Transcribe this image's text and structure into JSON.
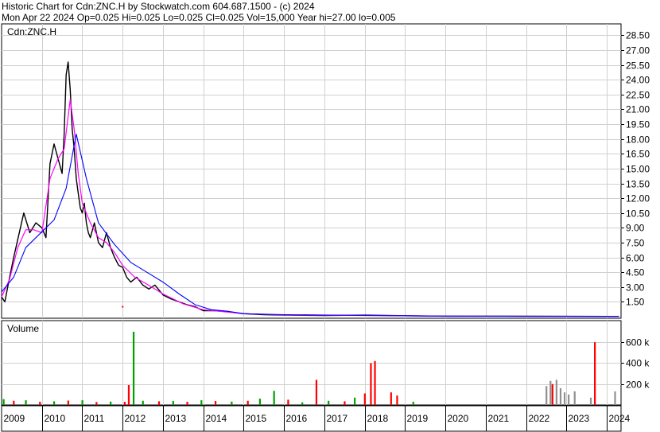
{
  "header": {
    "line1": "Historic Chart for Cdn:ZNC.H by Stockwatch.com 604.687.1500 - (c) 2024",
    "line2": "Mon Apr 22 2024   Op=0.025  Hi=0.025  Lo=0.025  Cl=0.025  Vol=15,000  Year hi=27.00  lo=0.005"
  },
  "chart_data": [
    {
      "type": "line",
      "panel": "price",
      "title": "Cdn:ZNC.H",
      "x_unit": "year (fractional)",
      "xlim": [
        2009.0,
        2024.35
      ],
      "ylim": [
        0,
        29.5
      ],
      "y_ticks": [
        "1.50",
        "3.00",
        "4.50",
        "6.00",
        "7.50",
        "9.00",
        "10.50",
        "12.00",
        "13.50",
        "15.00",
        "16.50",
        "18.00",
        "19.50",
        "21.00",
        "22.50",
        "24.00",
        "25.50",
        "27.00",
        "28.50"
      ],
      "x_tick_labels": [
        "2009",
        "2010",
        "2011",
        "2012",
        "2013",
        "2014",
        "2015",
        "2016",
        "2017",
        "2018",
        "2019",
        "2020",
        "2021",
        "2022",
        "2023",
        "2024"
      ],
      "grid": true,
      "colors": {
        "price": "#000000",
        "ma_short": "#ff00ff",
        "ma_long": "#0000ff",
        "marker": "#ff0000"
      },
      "series": [
        {
          "role": "price",
          "x": [
            2009.0,
            2009.08,
            2009.2,
            2009.3,
            2009.4,
            2009.55,
            2009.7,
            2009.85,
            2010.0,
            2010.1,
            2010.2,
            2010.3,
            2010.4,
            2010.5,
            2010.55,
            2010.6,
            2010.65,
            2010.7,
            2010.75,
            2010.8,
            2010.85,
            2010.9,
            2010.95,
            2011.0,
            2011.05,
            2011.1,
            2011.15,
            2011.2,
            2011.3,
            2011.4,
            2011.5,
            2011.6,
            2011.7,
            2011.8,
            2011.9,
            2012.0,
            2012.1,
            2012.2,
            2012.35,
            2012.5,
            2012.65,
            2012.8,
            2013.0,
            2013.2,
            2013.4,
            2013.6,
            2013.8,
            2014.0,
            2014.3,
            2014.6,
            2015.0,
            2015.5,
            2016.0,
            2017.0,
            2018.0,
            2019.0,
            2020.0,
            2021.0,
            2022.0,
            2023.0,
            2024.0,
            2024.3
          ],
          "y": [
            2.0,
            1.5,
            4.0,
            6.0,
            7.8,
            10.5,
            8.5,
            9.5,
            9.0,
            8.0,
            15.5,
            17.5,
            16.0,
            14.5,
            18.5,
            24.5,
            25.8,
            23.0,
            19.0,
            17.0,
            14.0,
            12.5,
            11.0,
            10.5,
            11.5,
            9.5,
            8.5,
            8.0,
            9.5,
            7.5,
            7.0,
            8.5,
            7.0,
            6.0,
            5.2,
            5.0,
            4.0,
            3.5,
            4.0,
            3.2,
            2.8,
            3.2,
            2.2,
            1.8,
            1.5,
            1.2,
            1.0,
            0.6,
            0.6,
            0.5,
            0.3,
            0.2,
            0.15,
            0.12,
            0.15,
            0.1,
            0.05,
            0.05,
            0.04,
            0.03,
            0.025,
            0.025
          ]
        },
        {
          "role": "ma_short",
          "x": [
            2009.0,
            2009.2,
            2009.4,
            2009.6,
            2009.8,
            2010.0,
            2010.2,
            2010.4,
            2010.55,
            2010.7,
            2010.8,
            2010.9,
            2011.0,
            2011.2,
            2011.4,
            2011.6,
            2011.8,
            2012.0,
            2012.3,
            2012.6,
            2013.0,
            2013.5,
            2014.0,
            2014.5,
            2015.0,
            2016.0,
            2018.0,
            2020.0,
            2022.0,
            2024.3
          ],
          "y": [
            2.0,
            3.8,
            7.0,
            8.8,
            8.8,
            8.5,
            14.0,
            16.0,
            17.0,
            22.0,
            19.0,
            14.5,
            11.5,
            9.5,
            8.0,
            7.5,
            6.5,
            5.2,
            4.0,
            3.3,
            2.3,
            1.3,
            0.7,
            0.5,
            0.3,
            0.18,
            0.12,
            0.06,
            0.04,
            0.03
          ]
        },
        {
          "role": "ma_long",
          "x": [
            2009.0,
            2009.3,
            2009.6,
            2010.0,
            2010.3,
            2010.6,
            2010.85,
            2011.1,
            2011.4,
            2011.8,
            2012.2,
            2012.6,
            2013.0,
            2013.4,
            2013.8,
            2014.2,
            2014.6,
            2015.0,
            2016.0,
            2018.0,
            2020.0,
            2022.0,
            2024.3
          ],
          "y": [
            2.5,
            4.0,
            7.0,
            8.6,
            9.8,
            13.0,
            18.5,
            14.0,
            9.5,
            7.3,
            5.5,
            4.5,
            3.5,
            2.3,
            1.2,
            0.7,
            0.55,
            0.3,
            0.2,
            0.12,
            0.06,
            0.04,
            0.03
          ]
        },
        {
          "role": "marker",
          "x": [
            2012.0
          ],
          "y": [
            1.0
          ]
        }
      ]
    },
    {
      "type": "bar",
      "panel": "volume",
      "title": "Volume",
      "x_unit": "year (fractional)",
      "xlim": [
        2009.0,
        2024.35
      ],
      "ylim": [
        0,
        700000
      ],
      "y_ticks": [
        "200 k",
        "400 k",
        "600 k"
      ],
      "y_tick_values": [
        200000,
        400000,
        600000
      ],
      "colors": {
        "up": "#00a000",
        "down": "#ff0000",
        "neutral": "#909090"
      },
      "x": [
        2009.05,
        2009.3,
        2009.6,
        2009.95,
        2010.3,
        2010.65,
        2011.0,
        2011.35,
        2011.7,
        2012.05,
        2012.15,
        2012.27,
        2012.5,
        2012.9,
        2013.25,
        2013.6,
        2013.95,
        2014.3,
        2014.7,
        2015.1,
        2015.4,
        2015.75,
        2016.1,
        2016.45,
        2016.8,
        2017.1,
        2017.5,
        2017.75,
        2018.0,
        2018.15,
        2018.25,
        2018.65,
        2018.8,
        2019.2,
        2022.5,
        2022.6,
        2022.65,
        2022.75,
        2022.85,
        2022.95,
        2023.05,
        2023.2,
        2023.6,
        2023.7,
        2024.2
      ],
      "values": [
        55000,
        40000,
        45000,
        30000,
        35000,
        42000,
        45000,
        28000,
        32000,
        30000,
        190000,
        700000,
        40000,
        35000,
        38000,
        30000,
        45000,
        38000,
        32000,
        40000,
        60000,
        135000,
        50000,
        25000,
        240000,
        40000,
        35000,
        70000,
        110000,
        400000,
        420000,
        120000,
        90000,
        30000,
        180000,
        230000,
        200000,
        240000,
        160000,
        120000,
        100000,
        130000,
        70000,
        600000,
        130000
      ],
      "colors_per_bar": [
        "green",
        "red",
        "green",
        "red",
        "green",
        "red",
        "green",
        "red",
        "green",
        "red",
        "red",
        "green",
        "green",
        "red",
        "green",
        "red",
        "green",
        "red",
        "green",
        "red",
        "green",
        "green",
        "red",
        "green",
        "red",
        "green",
        "red",
        "green",
        "red",
        "red",
        "red",
        "red",
        "red",
        "green",
        "gray",
        "gray",
        "red",
        "gray",
        "gray",
        "gray",
        "gray",
        "gray",
        "gray",
        "red",
        "gray"
      ]
    }
  ]
}
